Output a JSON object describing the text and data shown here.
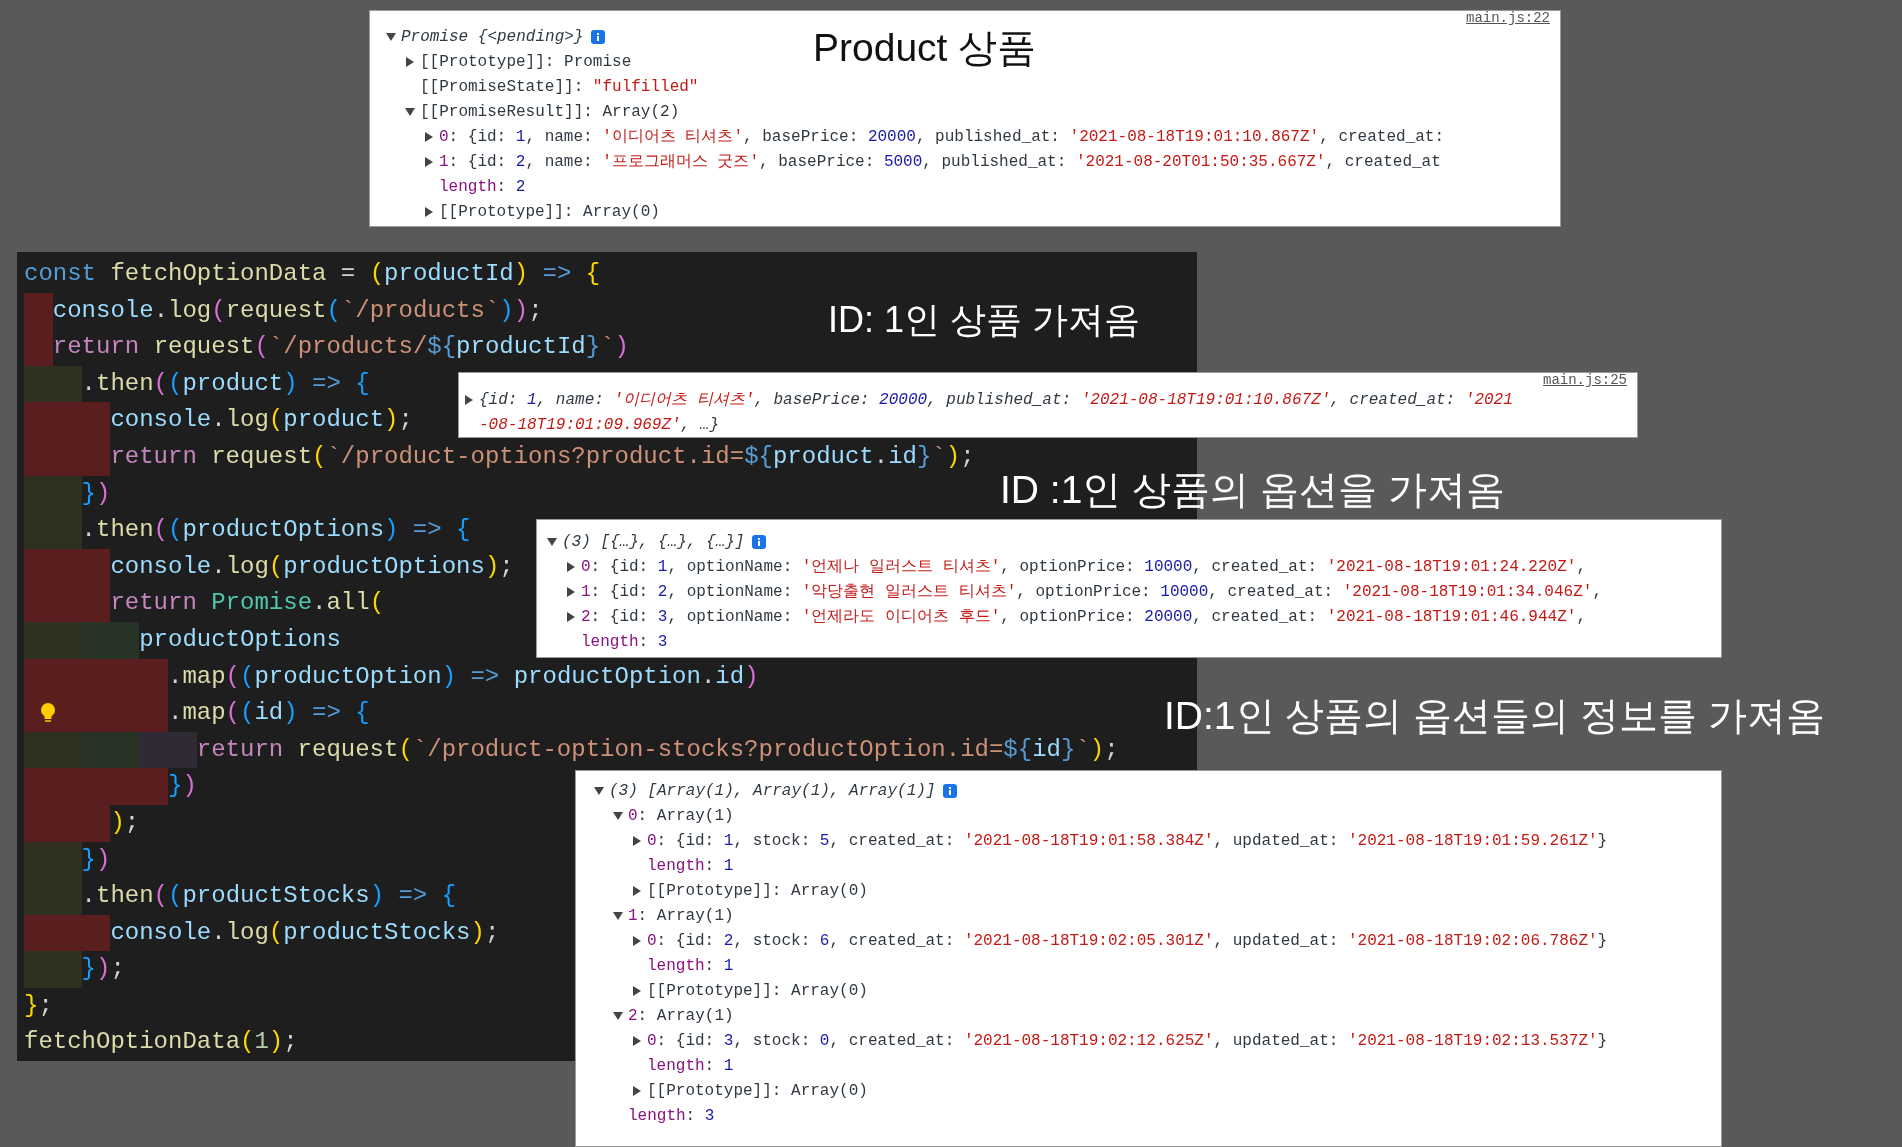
{
  "headings": [
    {
      "text": "Product 상품"
    },
    {
      "text": "ID: 1인 상품 가져옴"
    },
    {
      "text": "ID :1인 상품의 옵션을 가져옴"
    },
    {
      "text": "ID:1인 상품의 옵션들의 정보를 가져옴"
    }
  ],
  "code_editor": {
    "lines": [
      {
        "tokens": [
          {
            "text": "const ",
            "kind": "kw"
          },
          {
            "text": "fetchOptionData",
            "kind": "fn"
          },
          {
            "text": " = ",
            "kind": "p"
          },
          {
            "text": "(",
            "kind": "y"
          },
          {
            "text": "productId",
            "kind": "v"
          },
          {
            "text": ")",
            "kind": "y"
          },
          {
            "text": " => ",
            "kind": "kw"
          },
          {
            "text": "{",
            "kind": "y"
          }
        ]
      },
      {
        "guides": [
          {
            "color": "#5a1e1e"
          }
        ],
        "tokens": [
          {
            "text": "console",
            "kind": "v"
          },
          {
            "text": ".",
            "kind": "p"
          },
          {
            "text": "log",
            "kind": "fn"
          },
          {
            "text": "(",
            "kind": "m"
          },
          {
            "text": "request",
            "kind": "fn"
          },
          {
            "text": "(",
            "kind": "b"
          },
          {
            "text": "`/products`",
            "kind": "s"
          },
          {
            "text": ")",
            "kind": "b"
          },
          {
            "text": ")",
            "kind": "m"
          },
          {
            "text": ";",
            "kind": "p"
          }
        ]
      },
      {
        "guides": [
          {
            "color": "#5a1e1e"
          }
        ],
        "tokens": [
          {
            "text": "return ",
            "kind": "ctl"
          },
          {
            "text": "request",
            "kind": "fn"
          },
          {
            "text": "(",
            "kind": "m"
          },
          {
            "text": "`/products/",
            "kind": "s"
          },
          {
            "text": "${",
            "kind": "kw"
          },
          {
            "text": "productId",
            "kind": "v"
          },
          {
            "text": "}",
            "kind": "kw"
          },
          {
            "text": "`",
            "kind": "s"
          },
          {
            "text": ")",
            "kind": "m"
          }
        ]
      },
      {
        "guides": [
          {
            "color": "#2e3020"
          },
          {
            "color": "#2e3020"
          }
        ],
        "tokens": [
          {
            "text": ".",
            "kind": "p"
          },
          {
            "text": "then",
            "kind": "fn"
          },
          {
            "text": "(",
            "kind": "m"
          },
          {
            "text": "(",
            "kind": "b"
          },
          {
            "text": "product",
            "kind": "v"
          },
          {
            "text": ")",
            "kind": "b"
          },
          {
            "text": " => ",
            "kind": "kw"
          },
          {
            "text": "{",
            "kind": "b"
          }
        ]
      },
      {
        "guides": [
          {
            "color": "#5a1e1e"
          },
          {
            "color": "#5a1e1e"
          },
          {
            "color": "#5a1e1e"
          }
        ],
        "tokens": [
          {
            "text": "console",
            "kind": "v"
          },
          {
            "text": ".",
            "kind": "p"
          },
          {
            "text": "log",
            "kind": "fn"
          },
          {
            "text": "(",
            "kind": "y"
          },
          {
            "text": "product",
            "kind": "v"
          },
          {
            "text": ")",
            "kind": "y"
          },
          {
            "text": ";",
            "kind": "p"
          }
        ]
      },
      {
        "guides": [
          {
            "color": "#5a1e1e"
          },
          {
            "color": "#5a1e1e"
          },
          {
            "color": "#5a1e1e"
          }
        ],
        "tokens": [
          {
            "text": "return ",
            "kind": "ctl"
          },
          {
            "text": "request",
            "kind": "fn"
          },
          {
            "text": "(",
            "kind": "y"
          },
          {
            "text": "`/product-options?product.id=",
            "kind": "s"
          },
          {
            "text": "${",
            "kind": "kw"
          },
          {
            "text": "product",
            "kind": "v"
          },
          {
            "text": ".",
            "kind": "p"
          },
          {
            "text": "id",
            "kind": "v"
          },
          {
            "text": "}",
            "kind": "kw"
          },
          {
            "text": "`",
            "kind": "s"
          },
          {
            "text": ")",
            "kind": "y"
          },
          {
            "text": ";",
            "kind": "p"
          }
        ]
      },
      {
        "guides": [
          {
            "color": "#2e3020"
          },
          {
            "color": "#2e3020"
          }
        ],
        "tokens": [
          {
            "text": "}",
            "kind": "b"
          },
          {
            "text": ")",
            "kind": "m"
          }
        ]
      },
      {
        "guides": [
          {
            "color": "#2e3020"
          },
          {
            "color": "#2e3020"
          }
        ],
        "tokens": [
          {
            "text": ".",
            "kind": "p"
          },
          {
            "text": "then",
            "kind": "fn"
          },
          {
            "text": "(",
            "kind": "m"
          },
          {
            "text": "(",
            "kind": "b"
          },
          {
            "text": "productOptions",
            "kind": "v"
          },
          {
            "text": ")",
            "kind": "b"
          },
          {
            "text": " => ",
            "kind": "kw"
          },
          {
            "text": "{",
            "kind": "b"
          }
        ]
      },
      {
        "guides": [
          {
            "color": "#5a1e1e"
          },
          {
            "color": "#5a1e1e"
          },
          {
            "color": "#5a1e1e"
          }
        ],
        "tokens": [
          {
            "text": "console",
            "kind": "v"
          },
          {
            "text": ".",
            "kind": "p"
          },
          {
            "text": "log",
            "kind": "fn"
          },
          {
            "text": "(",
            "kind": "y"
          },
          {
            "text": "productOptions",
            "kind": "v"
          },
          {
            "text": ")",
            "kind": "y"
          },
          {
            "text": ";",
            "kind": "p"
          }
        ]
      },
      {
        "guides": [
          {
            "color": "#5a1e1e"
          },
          {
            "color": "#5a1e1e"
          },
          {
            "color": "#5a1e1e"
          }
        ],
        "tokens": [
          {
            "text": "return ",
            "kind": "ctl"
          },
          {
            "text": "Promise",
            "kind": "c"
          },
          {
            "text": ".",
            "kind": "p"
          },
          {
            "text": "all",
            "kind": "fn"
          },
          {
            "text": "(",
            "kind": "y"
          }
        ]
      },
      {
        "guides": [
          {
            "color": "#2e3020"
          },
          {
            "color": "#2e3020"
          },
          {
            "color": "#263326"
          },
          {
            "color": "#263326"
          }
        ],
        "tokens": [
          {
            "text": "productOptions",
            "kind": "v"
          }
        ]
      },
      {
        "guides": [
          {
            "color": "#5a1e1e"
          },
          {
            "color": "#5a1e1e"
          },
          {
            "color": "#5a1e1e"
          },
          {
            "color": "#5a1e1e"
          },
          {
            "color": "#5a1e1e"
          }
        ],
        "tokens": [
          {
            "text": ".",
            "kind": "p"
          },
          {
            "text": "map",
            "kind": "fn"
          },
          {
            "text": "(",
            "kind": "m"
          },
          {
            "text": "(",
            "kind": "b"
          },
          {
            "text": "productOption",
            "kind": "v"
          },
          {
            "text": ")",
            "kind": "b"
          },
          {
            "text": " => ",
            "kind": "kw"
          },
          {
            "text": "productOption",
            "kind": "v"
          },
          {
            "text": ".",
            "kind": "p"
          },
          {
            "text": "id",
            "kind": "v"
          },
          {
            "text": ")",
            "kind": "m"
          }
        ]
      },
      {
        "guides": [
          {
            "color": "#5a1e1e"
          },
          {
            "color": "#5a1e1e"
          },
          {
            "color": "#5a1e1e"
          },
          {
            "color": "#5a1e1e"
          },
          {
            "color": "#5a1e1e"
          }
        ],
        "lightbulb": true,
        "tokens": [
          {
            "text": ".",
            "kind": "p"
          },
          {
            "text": "map",
            "kind": "fn"
          },
          {
            "text": "(",
            "kind": "m"
          },
          {
            "text": "(",
            "kind": "b"
          },
          {
            "text": "id",
            "kind": "v"
          },
          {
            "text": ")",
            "kind": "b"
          },
          {
            "text": " => ",
            "kind": "kw"
          },
          {
            "text": "{",
            "kind": "b"
          }
        ]
      },
      {
        "guides": [
          {
            "color": "#2e3020"
          },
          {
            "color": "#2e3020"
          },
          {
            "color": "#263326"
          },
          {
            "color": "#263326"
          },
          {
            "color": "#2f2a35"
          },
          {
            "color": "#2f2a35"
          }
        ],
        "tokens": [
          {
            "text": "return ",
            "kind": "ctl"
          },
          {
            "text": "request",
            "kind": "fn"
          },
          {
            "text": "(",
            "kind": "y"
          },
          {
            "text": "`/product-option-stocks?productOption.id=",
            "kind": "s"
          },
          {
            "text": "${",
            "kind": "kw"
          },
          {
            "text": "id",
            "kind": "v"
          },
          {
            "text": "}",
            "kind": "kw"
          },
          {
            "text": "`",
            "kind": "s"
          },
          {
            "text": ")",
            "kind": "y"
          },
          {
            "text": ";",
            "kind": "p"
          }
        ]
      },
      {
        "guides": [
          {
            "color": "#5a1e1e"
          },
          {
            "color": "#5a1e1e"
          },
          {
            "color": "#5a1e1e"
          },
          {
            "color": "#5a1e1e"
          },
          {
            "color": "#5a1e1e"
          }
        ],
        "tokens": [
          {
            "text": "}",
            "kind": "b"
          },
          {
            "text": ")",
            "kind": "m"
          }
        ]
      },
      {
        "guides": [
          {
            "color": "#5a1e1e"
          },
          {
            "color": "#5a1e1e"
          },
          {
            "color": "#5a1e1e"
          }
        ],
        "tokens": [
          {
            "text": ")",
            "kind": "y"
          },
          {
            "text": ";",
            "kind": "p"
          }
        ]
      },
      {
        "guides": [
          {
            "color": "#2e3020"
          },
          {
            "color": "#2e3020"
          }
        ],
        "tokens": [
          {
            "text": "}",
            "kind": "b"
          },
          {
            "text": ")",
            "kind": "m"
          }
        ]
      },
      {
        "guides": [
          {
            "color": "#2e3020"
          },
          {
            "color": "#2e3020"
          }
        ],
        "tokens": [
          {
            "text": ".",
            "kind": "p"
          },
          {
            "text": "then",
            "kind": "fn"
          },
          {
            "text": "(",
            "kind": "m"
          },
          {
            "text": "(",
            "kind": "b"
          },
          {
            "text": "productStocks",
            "kind": "v"
          },
          {
            "text": ")",
            "kind": "b"
          },
          {
            "text": " => ",
            "kind": "kw"
          },
          {
            "text": "{",
            "kind": "b"
          }
        ]
      },
      {
        "guides": [
          {
            "color": "#5a1e1e"
          },
          {
            "color": "#5a1e1e"
          },
          {
            "color": "#5a1e1e"
          }
        ],
        "tokens": [
          {
            "text": "console",
            "kind": "v"
          },
          {
            "text": ".",
            "kind": "p"
          },
          {
            "text": "log",
            "kind": "fn"
          },
          {
            "text": "(",
            "kind": "y"
          },
          {
            "text": "productStocks",
            "kind": "v"
          },
          {
            "text": ")",
            "kind": "y"
          },
          {
            "text": ";",
            "kind": "p"
          }
        ]
      },
      {
        "guides": [
          {
            "color": "#2e3020"
          },
          {
            "color": "#2e3020"
          }
        ],
        "tokens": [
          {
            "text": "}",
            "kind": "b"
          },
          {
            "text": ")",
            "kind": "m"
          },
          {
            "text": ";",
            "kind": "p"
          }
        ]
      },
      {
        "tokens": [
          {
            "text": "}",
            "kind": "y"
          },
          {
            "text": ";",
            "kind": "p"
          }
        ]
      },
      {
        "tokens": [
          {
            "text": "fetchOptionData",
            "kind": "fn"
          },
          {
            "text": "(",
            "kind": "y"
          },
          {
            "text": "1",
            "kind": "n"
          },
          {
            "text": ")",
            "kind": "y"
          },
          {
            "text": ";",
            "kind": "p"
          }
        ]
      }
    ]
  },
  "consoles": [
    {
      "source": "main.js:22",
      "entries": [
        {
          "kind": "branch",
          "expanded": true,
          "italic": true,
          "info": true,
          "tokens": [
            {
              "text": "Promise {<pending>}",
              "kind": "p"
            }
          ],
          "children": [
            {
              "kind": "branch",
              "expanded": false,
              "tokens": [
                {
                  "text": "[[Prototype]]: Promise",
                  "kind": "p"
                }
              ]
            },
            {
              "kind": "leaf",
              "tokens": [
                {
                  "text": "[[PromiseState]]: ",
                  "kind": "p"
                },
                {
                  "text": "\"fulfilled\"",
                  "kind": "s"
                }
              ]
            },
            {
              "kind": "branch",
              "expanded": true,
              "tokens": [
                {
                  "text": "[[PromiseResult]]: Array(2)",
                  "kind": "p"
                }
              ],
              "children": [
                {
                  "kind": "branch",
                  "expanded": false,
                  "tokens": [
                    {
                      "text": "0",
                      "kind": "k"
                    },
                    {
                      "text": ": {id: ",
                      "kind": "p"
                    },
                    {
                      "text": "1",
                      "kind": "n"
                    },
                    {
                      "text": ", name: ",
                      "kind": "p"
                    },
                    {
                      "text": "'이디어츠 티셔츠'",
                      "kind": "s"
                    },
                    {
                      "text": ", basePrice: ",
                      "kind": "p"
                    },
                    {
                      "text": "20000",
                      "kind": "n"
                    },
                    {
                      "text": ", published_at: ",
                      "kind": "p"
                    },
                    {
                      "text": "'2021-08-18T19:01:10.867Z'",
                      "kind": "s"
                    },
                    {
                      "text": ", created_at:",
                      "kind": "p"
                    }
                  ]
                },
                {
                  "kind": "branch",
                  "expanded": false,
                  "tokens": [
                    {
                      "text": "1",
                      "kind": "k"
                    },
                    {
                      "text": ": {id: ",
                      "kind": "p"
                    },
                    {
                      "text": "2",
                      "kind": "n"
                    },
                    {
                      "text": ", name: ",
                      "kind": "p"
                    },
                    {
                      "text": "'프로그래머스 굿즈'",
                      "kind": "s"
                    },
                    {
                      "text": ", basePrice: ",
                      "kind": "p"
                    },
                    {
                      "text": "5000",
                      "kind": "n"
                    },
                    {
                      "text": ", published_at: ",
                      "kind": "p"
                    },
                    {
                      "text": "'2021-08-20T01:50:35.667Z'",
                      "kind": "s"
                    },
                    {
                      "text": ", created_at",
                      "kind": "p"
                    }
                  ]
                },
                {
                  "kind": "leaf",
                  "tokens": [
                    {
                      "text": "length",
                      "kind": "k"
                    },
                    {
                      "text": ": ",
                      "kind": "p"
                    },
                    {
                      "text": "2",
                      "kind": "n"
                    }
                  ]
                },
                {
                  "kind": "branch",
                  "expanded": false,
                  "tokens": [
                    {
                      "text": "[[Prototype]]: Array(0)",
                      "kind": "p"
                    }
                  ]
                }
              ]
            }
          ]
        }
      ]
    },
    {
      "source": "main.js:25",
      "entries": [
        {
          "kind": "branch",
          "expanded": false,
          "italic": true,
          "tokens": [
            {
              "text": "{id: ",
              "kind": "p"
            },
            {
              "text": "1",
              "kind": "n"
            },
            {
              "text": ", name: ",
              "kind": "p"
            },
            {
              "text": "'이디어츠 티셔츠'",
              "kind": "s"
            },
            {
              "text": ", basePrice: ",
              "kind": "p"
            },
            {
              "text": "20000",
              "kind": "n"
            },
            {
              "text": ", published_at: ",
              "kind": "p"
            },
            {
              "text": "'2021-08-18T19:01:10.867Z'",
              "kind": "s"
            },
            {
              "text": ", created_at: ",
              "kind": "p"
            },
            {
              "text": "'2021",
              "kind": "s"
            }
          ]
        },
        {
          "kind": "leaf",
          "italic": true,
          "tokens": [
            {
              "text": "-08-18T19:01:09.969Z'",
              "kind": "s"
            },
            {
              "text": ", …}",
              "kind": "p"
            }
          ]
        }
      ]
    },
    {
      "entries": [
        {
          "kind": "branch",
          "expanded": true,
          "italic": true,
          "info": true,
          "tokens": [
            {
              "text": "(3) [{…}, {…}, {…}]",
              "kind": "p"
            }
          ],
          "children": [
            {
              "kind": "branch",
              "expanded": false,
              "tokens": [
                {
                  "text": "0",
                  "kind": "k"
                },
                {
                  "text": ": {id: ",
                  "kind": "p"
                },
                {
                  "text": "1",
                  "kind": "n"
                },
                {
                  "text": ", optionName: ",
                  "kind": "p"
                },
                {
                  "text": "'언제나 일러스트 티셔츠'",
                  "kind": "s"
                },
                {
                  "text": ", optionPrice: ",
                  "kind": "p"
                },
                {
                  "text": "10000",
                  "kind": "n"
                },
                {
                  "text": ", created_at: ",
                  "kind": "p"
                },
                {
                  "text": "'2021-08-18T19:01:24.220Z'",
                  "kind": "s"
                },
                {
                  "text": ",",
                  "kind": "p"
                }
              ]
            },
            {
              "kind": "branch",
              "expanded": false,
              "tokens": [
                {
                  "text": "1",
                  "kind": "k"
                },
                {
                  "text": ": {id: ",
                  "kind": "p"
                },
                {
                  "text": "2",
                  "kind": "n"
                },
                {
                  "text": ", optionName: ",
                  "kind": "p"
                },
                {
                  "text": "'악당출현 일러스트 티셔츠'",
                  "kind": "s"
                },
                {
                  "text": ", optionPrice: ",
                  "kind": "p"
                },
                {
                  "text": "10000",
                  "kind": "n"
                },
                {
                  "text": ", created_at: ",
                  "kind": "p"
                },
                {
                  "text": "'2021-08-18T19:01:34.046Z'",
                  "kind": "s"
                },
                {
                  "text": ",",
                  "kind": "p"
                }
              ]
            },
            {
              "kind": "branch",
              "expanded": false,
              "tokens": [
                {
                  "text": "2",
                  "kind": "k"
                },
                {
                  "text": ": {id: ",
                  "kind": "p"
                },
                {
                  "text": "3",
                  "kind": "n"
                },
                {
                  "text": ", optionName: ",
                  "kind": "p"
                },
                {
                  "text": "'언제라도 이디어츠 후드'",
                  "kind": "s"
                },
                {
                  "text": ", optionPrice: ",
                  "kind": "p"
                },
                {
                  "text": "20000",
                  "kind": "n"
                },
                {
                  "text": ", created_at: ",
                  "kind": "p"
                },
                {
                  "text": "'2021-08-18T19:01:46.944Z'",
                  "kind": "s"
                },
                {
                  "text": ",",
                  "kind": "p"
                }
              ]
            },
            {
              "kind": "leaf",
              "tokens": [
                {
                  "text": "length",
                  "kind": "k"
                },
                {
                  "text": ": ",
                  "kind": "p"
                },
                {
                  "text": "3",
                  "kind": "n"
                }
              ]
            }
          ]
        }
      ]
    },
    {
      "entries": [
        {
          "kind": "branch",
          "expanded": true,
          "italic": true,
          "info": true,
          "tokens": [
            {
              "text": "(3) [Array(1), Array(1), Array(1)]",
              "kind": "p"
            }
          ],
          "children": [
            {
              "kind": "branch",
              "expanded": true,
              "tokens": [
                {
                  "text": "0",
                  "kind": "k"
                },
                {
                  "text": ": Array(1)",
                  "kind": "p"
                }
              ],
              "children": [
                {
                  "kind": "branch",
                  "expanded": false,
                  "tokens": [
                    {
                      "text": "0",
                      "kind": "k"
                    },
                    {
                      "text": ": {id: ",
                      "kind": "p"
                    },
                    {
                      "text": "1",
                      "kind": "n"
                    },
                    {
                      "text": ", stock: ",
                      "kind": "p"
                    },
                    {
                      "text": "5",
                      "kind": "n"
                    },
                    {
                      "text": ", created_at: ",
                      "kind": "p"
                    },
                    {
                      "text": "'2021-08-18T19:01:58.384Z'",
                      "kind": "s"
                    },
                    {
                      "text": ", updated_at: ",
                      "kind": "p"
                    },
                    {
                      "text": "'2021-08-18T19:01:59.261Z'",
                      "kind": "s"
                    },
                    {
                      "text": "}",
                      "kind": "p"
                    }
                  ]
                },
                {
                  "kind": "leaf",
                  "tokens": [
                    {
                      "text": "length",
                      "kind": "k"
                    },
                    {
                      "text": ": ",
                      "kind": "p"
                    },
                    {
                      "text": "1",
                      "kind": "n"
                    }
                  ]
                },
                {
                  "kind": "branch",
                  "expanded": false,
                  "tokens": [
                    {
                      "text": "[[Prototype]]: Array(0)",
                      "kind": "p"
                    }
                  ]
                }
              ]
            },
            {
              "kind": "branch",
              "expanded": true,
              "tokens": [
                {
                  "text": "1",
                  "kind": "k"
                },
                {
                  "text": ": Array(1)",
                  "kind": "p"
                }
              ],
              "children": [
                {
                  "kind": "branch",
                  "expanded": false,
                  "tokens": [
                    {
                      "text": "0",
                      "kind": "k"
                    },
                    {
                      "text": ": {id: ",
                      "kind": "p"
                    },
                    {
                      "text": "2",
                      "kind": "n"
                    },
                    {
                      "text": ", stock: ",
                      "kind": "p"
                    },
                    {
                      "text": "6",
                      "kind": "n"
                    },
                    {
                      "text": ", created_at: ",
                      "kind": "p"
                    },
                    {
                      "text": "'2021-08-18T19:02:05.301Z'",
                      "kind": "s"
                    },
                    {
                      "text": ", updated_at: ",
                      "kind": "p"
                    },
                    {
                      "text": "'2021-08-18T19:02:06.786Z'",
                      "kind": "s"
                    },
                    {
                      "text": "}",
                      "kind": "p"
                    }
                  ]
                },
                {
                  "kind": "leaf",
                  "tokens": [
                    {
                      "text": "length",
                      "kind": "k"
                    },
                    {
                      "text": ": ",
                      "kind": "p"
                    },
                    {
                      "text": "1",
                      "kind": "n"
                    }
                  ]
                },
                {
                  "kind": "branch",
                  "expanded": false,
                  "tokens": [
                    {
                      "text": "[[Prototype]]: Array(0)",
                      "kind": "p"
                    }
                  ]
                }
              ]
            },
            {
              "kind": "branch",
              "expanded": true,
              "tokens": [
                {
                  "text": "2",
                  "kind": "k"
                },
                {
                  "text": ": Array(1)",
                  "kind": "p"
                }
              ],
              "children": [
                {
                  "kind": "branch",
                  "expanded": false,
                  "tokens": [
                    {
                      "text": "0",
                      "kind": "k"
                    },
                    {
                      "text": ": {id: ",
                      "kind": "p"
                    },
                    {
                      "text": "3",
                      "kind": "n"
                    },
                    {
                      "text": ", stock: ",
                      "kind": "p"
                    },
                    {
                      "text": "0",
                      "kind": "n"
                    },
                    {
                      "text": ", created_at: ",
                      "kind": "p"
                    },
                    {
                      "text": "'2021-08-18T19:02:12.625Z'",
                      "kind": "s"
                    },
                    {
                      "text": ", updated_at: ",
                      "kind": "p"
                    },
                    {
                      "text": "'2021-08-18T19:02:13.537Z'",
                      "kind": "s"
                    },
                    {
                      "text": "}",
                      "kind": "p"
                    }
                  ]
                },
                {
                  "kind": "leaf",
                  "tokens": [
                    {
                      "text": "length",
                      "kind": "k"
                    },
                    {
                      "text": ": ",
                      "kind": "p"
                    },
                    {
                      "text": "1",
                      "kind": "n"
                    }
                  ]
                },
                {
                  "kind": "branch",
                  "expanded": false,
                  "tokens": [
                    {
                      "text": "[[Prototype]]: Array(0)",
                      "kind": "p"
                    }
                  ]
                }
              ]
            },
            {
              "kind": "leaf",
              "tokens": [
                {
                  "text": "length",
                  "kind": "k"
                },
                {
                  "text": ": ",
                  "kind": "p"
                },
                {
                  "text": "3",
                  "kind": "n"
                }
              ]
            }
          ]
        }
      ]
    }
  ]
}
